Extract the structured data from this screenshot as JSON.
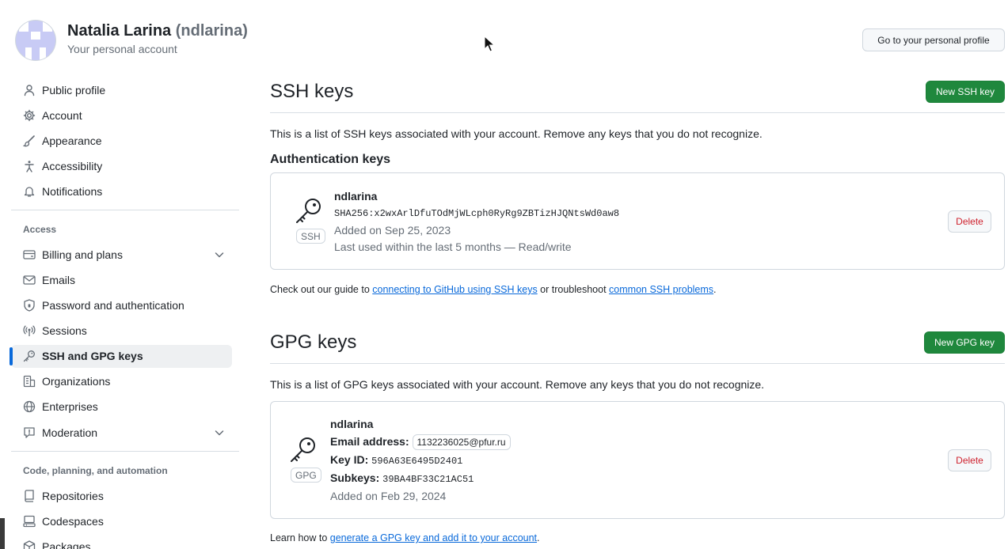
{
  "header": {
    "name": "Natalia Larina",
    "login": "(ndlarina)",
    "subtitle": "Your personal account",
    "profile_button": "Go to your personal profile"
  },
  "sidebar": {
    "top_items": [
      {
        "label": "Public profile",
        "icon": "person-icon"
      },
      {
        "label": "Account",
        "icon": "gear-icon"
      },
      {
        "label": "Appearance",
        "icon": "paintbrush-icon"
      },
      {
        "label": "Accessibility",
        "icon": "accessibility-icon"
      },
      {
        "label": "Notifications",
        "icon": "bell-icon"
      }
    ],
    "access_heading": "Access",
    "access_items": [
      {
        "label": "Billing and plans",
        "icon": "credit-card-icon"
      },
      {
        "label": "Emails",
        "icon": "mail-icon"
      },
      {
        "label": "Password and authentication",
        "icon": "shield-lock-icon"
      },
      {
        "label": "Sessions",
        "icon": "broadcast-icon"
      },
      {
        "label": "SSH and GPG keys",
        "icon": "key-icon"
      },
      {
        "label": "Organizations",
        "icon": "organization-icon"
      },
      {
        "label": "Enterprises",
        "icon": "globe-icon"
      },
      {
        "label": "Moderation",
        "icon": "report-icon"
      }
    ],
    "code_heading": "Code, planning, and automation",
    "code_items": [
      {
        "label": "Repositories",
        "icon": "repo-icon"
      },
      {
        "label": "Codespaces",
        "icon": "codespaces-icon"
      },
      {
        "label": "Packages",
        "icon": "package-icon"
      }
    ]
  },
  "ssh": {
    "title": "SSH keys",
    "new_button": "New SSH key",
    "description": "This is a list of SSH keys associated with your account. Remove any keys that you do not recognize.",
    "auth_heading": "Authentication keys",
    "key": {
      "tag": "SSH",
      "name": "ndlarina",
      "fingerprint": "SHA256:x2wxArlDfuTOdMjWLcph0RyRg9ZBTizHJQNtsWd0aw8",
      "added": "Added on Sep 25, 2023",
      "last_used": "Last used within the last 5 months — Read/write",
      "delete_label": "Delete"
    },
    "guide": {
      "prefix": "Check out our guide to ",
      "link1": "connecting to GitHub using SSH keys",
      "middle": " or troubleshoot ",
      "link2": "common SSH problems",
      "suffix": "."
    }
  },
  "gpg": {
    "title": "GPG keys",
    "new_button": "New GPG key",
    "description": "This is a list of GPG keys associated with your account. Remove any keys that you do not recognize.",
    "key": {
      "tag": "GPG",
      "name": "ndlarina",
      "email_label": "Email address:",
      "email": "1132236025@pfur.ru",
      "keyid_label": "Key ID:",
      "keyid": "596A63E6495D2401",
      "subkeys_label": "Subkeys:",
      "subkeys": "39BA4BF33C21AC51",
      "added": "Added on Feb 29, 2024",
      "delete_label": "Delete"
    },
    "learn": {
      "prefix": "Learn how to ",
      "link": "generate a GPG key and add it to your account",
      "suffix": "."
    }
  },
  "colors": {
    "primary_green": "#1f883d",
    "link_blue": "#0969da",
    "danger_red": "#cf222e",
    "active_indicator": "#0969da",
    "avatar_bg": "#c8cbf5"
  }
}
